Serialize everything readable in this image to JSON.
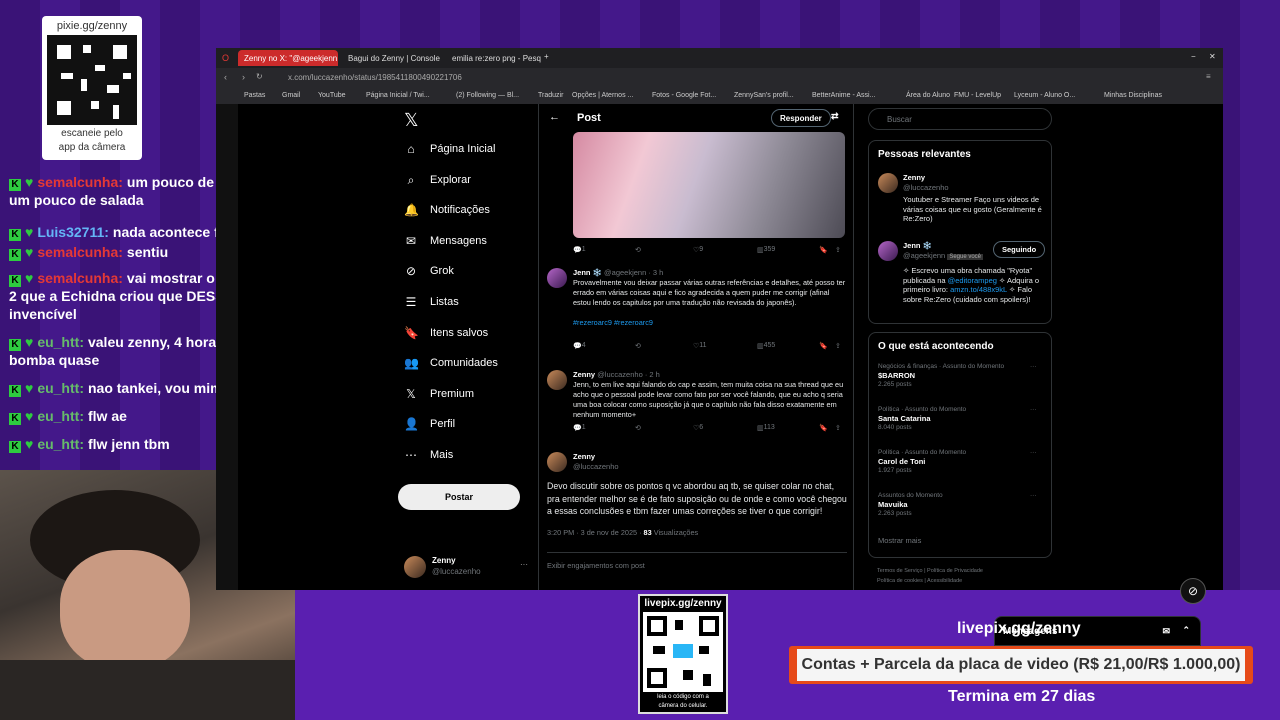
{
  "overlay": {
    "qr_url": "pixie.gg/zenny",
    "qr_caption_1": "escaneie pelo",
    "qr_caption_2": "app da câmera",
    "live_url": "livepix.gg/zenny",
    "live_caption_1": "leia o código com a",
    "live_caption_2": "câmera do celular.",
    "goal_url": "livepix.gg/zenny",
    "goal_text": "Contas + Parcela da placa de video (R$ 21,00/R$ 1.000,00)",
    "goal_progress": 0.021,
    "goal_end": "Termina em 27 dias"
  },
  "chat": [
    {
      "user": "semalcunha:",
      "text": "um pouco de droga e um pouco de salada",
      "color": "#e53935"
    },
    {
      "user": "Luis32711:",
      "text": "nada acontece feijoada",
      "color": "#64b5f6"
    },
    {
      "user": "semalcunha:",
      "text": "sentiu",
      "color": "#e53935"
    },
    {
      "user": "semalcunha:",
      "text": "vai mostrar o Aldebaran 2 que a Echidna criou que DESSA VEZ é invencível",
      "color": "#e53935"
    },
    {
      "user": "eu_htt:",
      "text": "valeu zenny, 4 hora nessa bomba quase",
      "color": "#66bb6a"
    },
    {
      "user": "eu_htt:",
      "text": "nao tankei, vou mimir",
      "color": "#66bb6a"
    },
    {
      "user": "eu_htt:",
      "text": "flw ae",
      "color": "#66bb6a"
    },
    {
      "user": "eu_htt:",
      "text": "flw jenn tbm",
      "color": "#66bb6a"
    }
  ],
  "browser": {
    "tabs": [
      "Zenny no X: \"@ageekjenn",
      "Bagui do Zenny | Console",
      "emilia re:zero png - Pesq"
    ],
    "url": "x.com/luccazenho/status/1985411800490221706",
    "bookmarks": [
      "Pastas",
      "Gmail",
      "YouTube",
      "Página Inicial / Twi...",
      "(2) Following — Bl...",
      "Traduzir",
      "Opções | Aternos ...",
      "Fotos - Google Fot...",
      "ZennySan's profil...",
      "BetterAnime - Assi...",
      "Área do Aluno",
      "FMU - LevelUp",
      "Lyceum - Aluno O...",
      "Minhas Disciplinas"
    ]
  },
  "nav": {
    "items": [
      "Página Inicial",
      "Explorar",
      "Notificações",
      "Mensagens",
      "Grok",
      "Listas",
      "Itens salvos",
      "Comunidades",
      "Premium",
      "Perfil",
      "Mais"
    ],
    "post_button": "Postar",
    "account_name": "Zenny",
    "account_handle": "@luccazenho"
  },
  "post": {
    "header": "Post",
    "reply_button": "Responder",
    "img_actions": {
      "replies": "1",
      "likes": "9",
      "views": "359"
    },
    "t1": {
      "name": "Jenn ❄️",
      "handle": "@ageekjenn · 3 h",
      "text": "Provavelmente vou deixar passar várias outras referências e detalhes, até posso ter errado em várias coisas aqui e fico agradecida a quem puder me corrigir (afinal estou lendo os capitulos por uma tradução não revisada do japonês).",
      "tags": "#rezeroarc9 #rezeroarc9",
      "replies": "4",
      "likes": "11",
      "views": "455"
    },
    "t2": {
      "name": "Zenny",
      "handle": "@luccazenho · 2 h",
      "text": "Jenn, to em live aqui falando do cap e assim, tem muita coisa na sua thread que eu acho que o pessoal pode levar como fato por ser você falando, que eu acho q seria uma boa colocar como suposição já que o capítulo não fala disso exatamente em nenhum momento+",
      "replies": "1",
      "likes": "6",
      "views": "113"
    },
    "t3": {
      "name": "Zenny",
      "handle": "@luccazenho",
      "text": "Devo discutir sobre os pontos q vc abordou aq tb, se quiser colar no chat, pra entender melhor se é de fato suposição ou de onde e como você chegou a essas conclusões e tbm fazer umas correções se tiver o que corrigir!",
      "time": "3:20 PM · 3 de nov de 2025 ·",
      "views": "83",
      "views_label": "Visualizações",
      "engagements": "Exibir engajamentos com post"
    }
  },
  "sidebar": {
    "search_placeholder": "Buscar",
    "relevant_title": "Pessoas relevantes",
    "p1": {
      "name": "Zenny",
      "handle": "@luccazenho",
      "bio": "Youtuber e Streamer Faço uns videos de várias coisas que eu gosto (Geralmente é Re:Zero)"
    },
    "p2": {
      "name": "Jenn ❄️",
      "handle": "@ageekjenn",
      "badge": "Segue você",
      "follow": "Seguindo",
      "bio1": "✧ Escrevo uma obra chamada \"Ryota\" publicada na",
      "bio_link1": "@editorampeg",
      "bio2": "✧ Adquira o primeiro livro:",
      "bio_link2": "amzn.to/488x9kL",
      "bio3": "✧ Falo sobre Re:Zero (cuidado com spoilers)!"
    },
    "trends_title": "O que está acontecendo",
    "trends": [
      {
        "cat": "Negócios & finanças · Assunto do Momento",
        "name": "$BARRON",
        "count": "2.265 posts"
      },
      {
        "cat": "Política · Assunto do Momento",
        "name": "Santa Catarina",
        "count": "8.040 posts"
      },
      {
        "cat": "Política · Assunto do Momento",
        "name": "Carol de Toni",
        "count": "1.927 posts"
      },
      {
        "cat": "Assuntos do Momento",
        "name": "Mavuika",
        "count": "2.263 posts"
      }
    ],
    "show_more": "Mostrar mais",
    "footer1": "Termos de Serviço | Política de Privacidade",
    "footer2": "Política de cookies | Acessibilidade",
    "messages": "Mensagens"
  }
}
